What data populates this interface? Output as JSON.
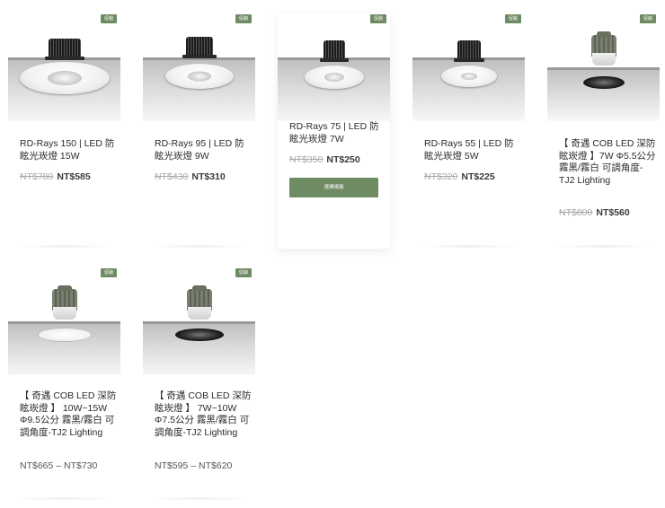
{
  "products": [
    {
      "badge": "促銷",
      "title": "RD-Rays 150 | LED 防眩光崁燈 15W",
      "old_price": "NT$780",
      "new_price": "NT$585"
    },
    {
      "badge": "促銷",
      "title": "RD-Rays 95 | LED 防眩光崁燈 9W",
      "old_price": "NT$430",
      "new_price": "NT$310"
    },
    {
      "badge": "促銷",
      "title": "RD-Rays 75 | LED 防眩光崁燈 7W",
      "old_price": "NT$350",
      "new_price": "NT$250",
      "button": "選擇規格"
    },
    {
      "badge": "促銷",
      "title": "RD-Rays 55 | LED 防眩光崁燈 5W",
      "old_price": "NT$320",
      "new_price": "NT$225"
    },
    {
      "badge": "促銷",
      "title": "【 奇遇 COB LED 深防眩崁燈 】7W Φ5.5公分 霧黑/霧白 可調角度-TJ2 Lighting",
      "old_price": "NT$800",
      "new_price": "NT$560"
    },
    {
      "badge": "促銷",
      "title": "【 奇遇 COB LED 深防眩崁燈 】 10W~15W Φ9.5公分 霧黑/霧白 可調角度-TJ2 Lighting",
      "price_range": "NT$665 – NT$730"
    },
    {
      "badge": "促銷",
      "title": "【 奇遇 COB LED 深防眩崁燈 】 7W~10W Φ7.5公分 霧黑/霧白 可調角度-TJ2 Lighting",
      "price_range": "NT$595 – NT$620"
    }
  ]
}
